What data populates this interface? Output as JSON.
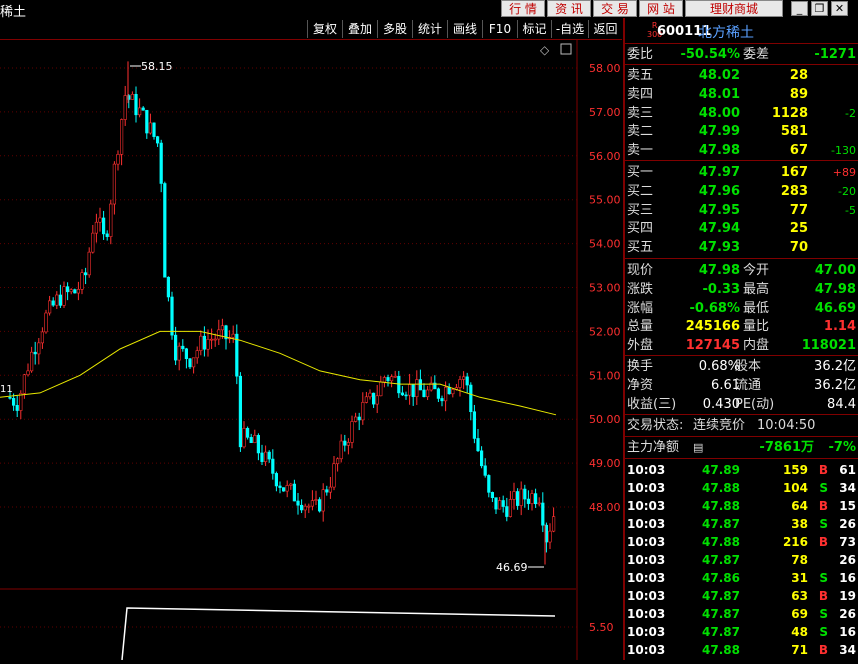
{
  "window": {
    "title": "稀土",
    "nav_buttons": [
      "行 情",
      "资 讯",
      "交 易",
      "网 站",
      "理财商城"
    ],
    "controls": [
      "_",
      "❐",
      "✕"
    ]
  },
  "toolbar": {
    "buttons": [
      "复权",
      "叠加",
      "多股",
      "统计",
      "画线",
      "F10",
      "标记",
      "-自选",
      "返回"
    ],
    "icons": [
      "diamond-icon",
      "window-icon"
    ]
  },
  "chart": {
    "price_labels": [
      "58.00",
      "57.00",
      "56.00",
      "55.00",
      "54.00",
      "53.00",
      "52.00",
      "51.00",
      "50.00",
      "49.00",
      "48.00",
      "5.50"
    ],
    "high_marker": "58.15",
    "low_marker": "46.69",
    "left_edge_label": "11"
  },
  "chart_data": {
    "type": "candlestick",
    "ylim": [
      46.2,
      58.5
    ],
    "high": 58.15,
    "low": 46.69,
    "ma_color": "#e8e800",
    "up_color": "#ff3030",
    "down_color": "#00ffff"
  },
  "quote": {
    "badge_top": "R",
    "badge_bottom": "300",
    "code": "600111",
    "name": "北方稀土",
    "weibi_label": "委比",
    "weibi_value": "-50.54%",
    "weicha_label": "委差",
    "weicha_value": "-1271",
    "asks": [
      {
        "label": "卖五",
        "price": "48.02",
        "vol": "28",
        "chg": ""
      },
      {
        "label": "卖四",
        "price": "48.01",
        "vol": "89",
        "chg": ""
      },
      {
        "label": "卖三",
        "price": "48.00",
        "vol": "1128",
        "chg": "-2"
      },
      {
        "label": "卖二",
        "price": "47.99",
        "vol": "581",
        "chg": ""
      },
      {
        "label": "卖一",
        "price": "47.98",
        "vol": "67",
        "chg": "-130"
      }
    ],
    "bids": [
      {
        "label": "买一",
        "price": "47.97",
        "vol": "167",
        "chg": "+89"
      },
      {
        "label": "买二",
        "price": "47.96",
        "vol": "283",
        "chg": "-20"
      },
      {
        "label": "买三",
        "price": "47.95",
        "vol": "77",
        "chg": "-5"
      },
      {
        "label": "买四",
        "price": "47.94",
        "vol": "25",
        "chg": ""
      },
      {
        "label": "买五",
        "price": "47.93",
        "vol": "70",
        "chg": ""
      }
    ],
    "stats": [
      {
        "l1": "现价",
        "v1": "47.98",
        "c1": "green",
        "l2": "今开",
        "v2": "47.00",
        "c2": "green"
      },
      {
        "l1": "涨跌",
        "v1": "-0.33",
        "c1": "green",
        "l2": "最高",
        "v2": "47.98",
        "c2": "green"
      },
      {
        "l1": "涨幅",
        "v1": "-0.68%",
        "c1": "green",
        "l2": "最低",
        "v2": "46.69",
        "c2": "green"
      },
      {
        "l1": "总量",
        "v1": "245166",
        "c1": "yellow",
        "l2": "量比",
        "v2": "1.14",
        "c2": "red"
      },
      {
        "l1": "外盘",
        "v1": "127145",
        "c1": "red",
        "l2": "内盘",
        "v2": "118021",
        "c2": "green"
      }
    ],
    "fund": [
      {
        "l1": "换手",
        "v1": "0.68%",
        "l2": "股本",
        "v2": "36.2亿"
      },
      {
        "l1": "净资",
        "v1": "6.61",
        "l2": "流通",
        "v2": "36.2亿"
      },
      {
        "l1": "收益(三)",
        "v1": "0.430",
        "l2": "PE(动)",
        "v2": "84.4"
      }
    ],
    "status_label": "交易状态:",
    "status_value": "连续竞价",
    "status_time": "10:04:50",
    "net_label": "主力净额",
    "net_value": "-7861万",
    "net_pct": "-7%",
    "ticks": [
      {
        "time": "10:03",
        "price": "47.89",
        "vol": "159",
        "bs": "B",
        "n": "61"
      },
      {
        "time": "10:03",
        "price": "47.88",
        "vol": "104",
        "bs": "S",
        "n": "34"
      },
      {
        "time": "10:03",
        "price": "47.88",
        "vol": "64",
        "bs": "B",
        "n": "15"
      },
      {
        "time": "10:03",
        "price": "47.87",
        "vol": "38",
        "bs": "S",
        "n": "26"
      },
      {
        "time": "10:03",
        "price": "47.88",
        "vol": "216",
        "bs": "B",
        "n": "73"
      },
      {
        "time": "10:03",
        "price": "47.87",
        "vol": "78",
        "bs": "",
        "n": "26"
      },
      {
        "time": "10:03",
        "price": "47.86",
        "vol": "31",
        "bs": "S",
        "n": "16"
      },
      {
        "time": "10:03",
        "price": "47.87",
        "vol": "63",
        "bs": "B",
        "n": "19"
      },
      {
        "time": "10:03",
        "price": "47.87",
        "vol": "69",
        "bs": "S",
        "n": "26"
      },
      {
        "time": "10:03",
        "price": "47.87",
        "vol": "48",
        "bs": "S",
        "n": "16"
      },
      {
        "time": "10:03",
        "price": "47.88",
        "vol": "71",
        "bs": "B",
        "n": "34"
      }
    ]
  }
}
